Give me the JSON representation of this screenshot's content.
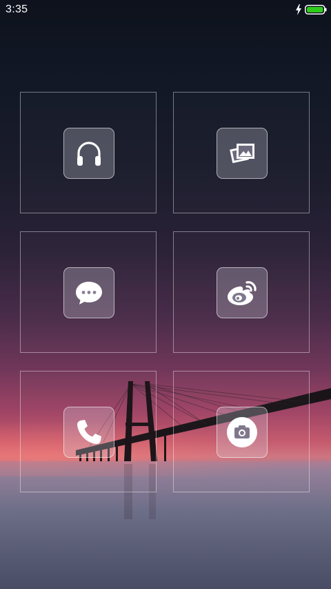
{
  "status_bar": {
    "time": "3:35",
    "charging": true,
    "battery_level": 1.0,
    "battery_color": "#2ecc1b"
  },
  "wallpaper": {
    "scene": "bridge-at-sunset"
  },
  "apps": [
    {
      "name": "music",
      "icon": "headphones-icon"
    },
    {
      "name": "gallery",
      "icon": "photos-icon"
    },
    {
      "name": "messages",
      "icon": "chat-bubble-icon"
    },
    {
      "name": "weibo",
      "icon": "weibo-icon"
    },
    {
      "name": "phone",
      "icon": "phone-icon"
    },
    {
      "name": "camera",
      "icon": "camera-icon"
    }
  ]
}
